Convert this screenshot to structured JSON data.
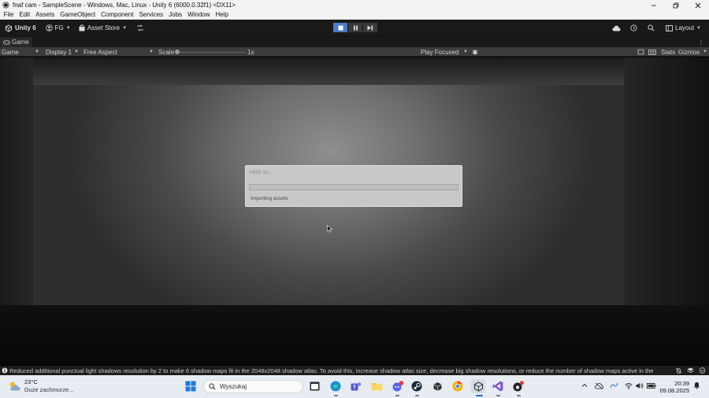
{
  "window": {
    "title": "fnaf cam - SampleScene - Windows, Mac, Linux - Unity 6 (6000.0.32f1) <DX11>",
    "icon": "unity-icon",
    "controls": [
      "minimize-icon",
      "restore-icon",
      "close-icon"
    ]
  },
  "menu": [
    "File",
    "Edit",
    "Assets",
    "GameObject",
    "Component",
    "Services",
    "Jobs",
    "Window",
    "Help"
  ],
  "toolbar": {
    "unity_label": "Unity 6",
    "account_label": "FG",
    "asset_store_label": "Asset Store",
    "layout_label": "Layout",
    "play_controls": [
      "play-icon",
      "pause-icon",
      "step-icon"
    ],
    "play_active": true,
    "accent": "#4e7ac7"
  },
  "tab": {
    "label": "Game"
  },
  "game_toolbar": {
    "mode": "Game",
    "display": "Display 1",
    "aspect": "Free Aspect",
    "scale_label": "Scale",
    "scale_value": "1x",
    "play_mode": "Play Focused",
    "stats_label": "Stats",
    "gizmos_label": "Gizmos"
  },
  "dialog": {
    "title": "Hold on...",
    "info": "Importing assets",
    "progress": 0.0
  },
  "status": {
    "message": "Reduced additional punctual light shadows resolution by 2 to make 6 shadow maps fit in the 2048x2048 shadow atlas. To avoid this, increase shadow atlas size, decrease big shadow resolutions, or reduce the number of shadow maps active in the"
  },
  "taskbar": {
    "weather_temp": "23°C",
    "weather_desc": "Duże zachmurze...",
    "search_placeholder": "Wyszukaj",
    "time": "20:39",
    "date": "09.08.2025"
  }
}
